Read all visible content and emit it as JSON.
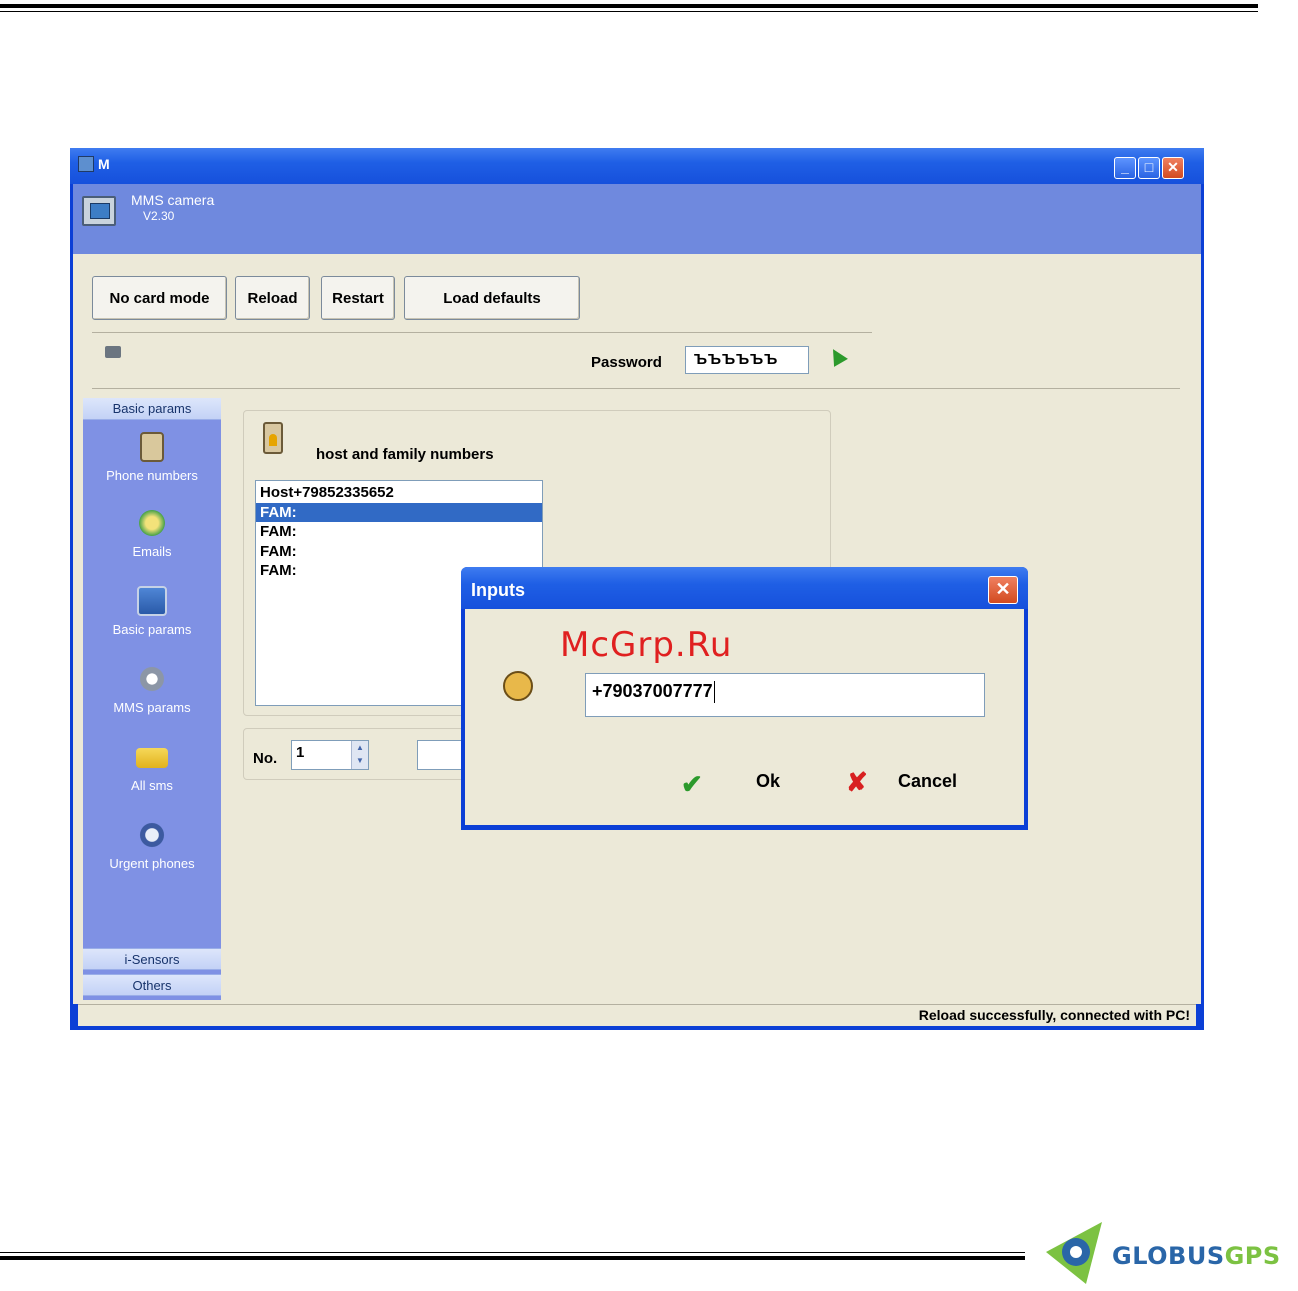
{
  "window": {
    "title": "M",
    "app_name": "MMS camera",
    "version": "V2.30",
    "controls": {
      "minimize": "_",
      "maximize": "□",
      "close": "✕"
    }
  },
  "toolbar": {
    "no_card_mode": "No card mode",
    "reload": "Reload",
    "restart": "Restart",
    "load_defaults": "Load defaults"
  },
  "password": {
    "label": "Password",
    "value": "ЪЪЪЪЪЪ"
  },
  "sidebar": {
    "header": "Basic params",
    "items": [
      {
        "label": "Phone numbers",
        "icon": "clipboard-icon"
      },
      {
        "label": "Emails",
        "icon": "email-icon"
      },
      {
        "label": "Basic params",
        "icon": "settings-screen-icon"
      },
      {
        "label": "MMS params",
        "icon": "gear-tools-icon"
      },
      {
        "label": "All sms",
        "icon": "sms-envelope-icon"
      },
      {
        "label": "Urgent phones",
        "icon": "phone-icon"
      }
    ],
    "footer_sections": [
      "i-Sensors",
      "Others"
    ]
  },
  "content": {
    "group_title": "host and family numbers",
    "list": [
      {
        "text": "Host+79852335652",
        "selected": false
      },
      {
        "text": "FAM:",
        "selected": true
      },
      {
        "text": "FAM:",
        "selected": false
      },
      {
        "text": "FAM:",
        "selected": false
      },
      {
        "text": "FAM:",
        "selected": false
      }
    ],
    "no_label": "No.",
    "no_value": "1"
  },
  "status": {
    "text": "Reload successfully, connected with PC!"
  },
  "dialog": {
    "title": "Inputs",
    "close": "✕",
    "input_value": "+79037007777",
    "ok_label": "Ok",
    "cancel_label": "Cancel"
  },
  "watermark": "McGrp.Ru",
  "logo": {
    "part1": "GLOBUS",
    "part2": "GPS"
  }
}
